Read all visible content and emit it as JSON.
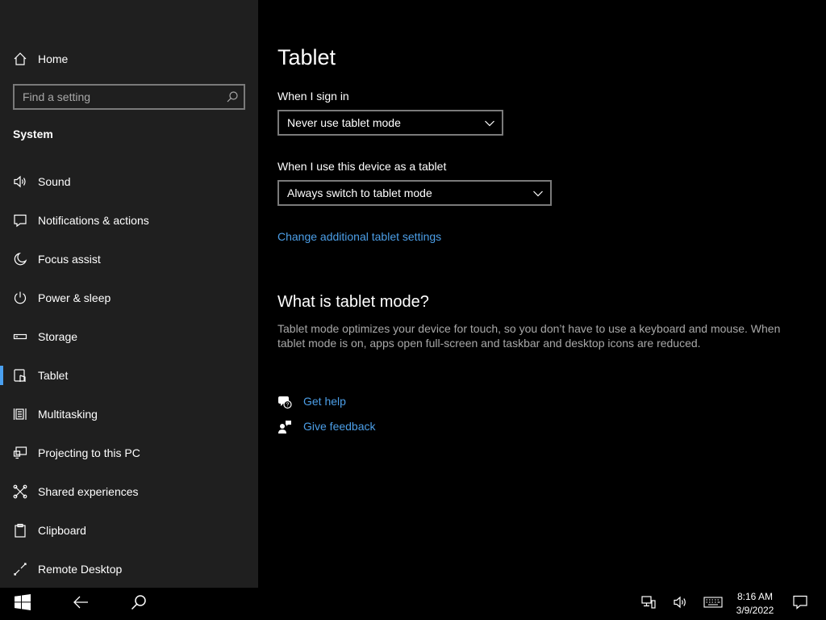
{
  "sidebar": {
    "home_label": "Home",
    "search_placeholder": "Find a setting",
    "section_title": "System",
    "items": [
      {
        "label": "Sound",
        "icon": "speaker-icon"
      },
      {
        "label": "Notifications & actions",
        "icon": "notification-icon"
      },
      {
        "label": "Focus assist",
        "icon": "moon-icon"
      },
      {
        "label": "Power & sleep",
        "icon": "power-icon"
      },
      {
        "label": "Storage",
        "icon": "storage-icon"
      },
      {
        "label": "Tablet",
        "icon": "tablet-icon",
        "active": true
      },
      {
        "label": "Multitasking",
        "icon": "multitasking-icon"
      },
      {
        "label": "Projecting to this PC",
        "icon": "projecting-icon"
      },
      {
        "label": "Shared experiences",
        "icon": "shared-icon"
      },
      {
        "label": "Clipboard",
        "icon": "clipboard-icon"
      },
      {
        "label": "Remote Desktop",
        "icon": "remote-desktop-icon"
      }
    ]
  },
  "main": {
    "title": "Tablet",
    "sign_in_label": "When I sign in",
    "sign_in_value": "Never use tablet mode",
    "device_label": "When I use this device as a tablet",
    "device_value": "Always switch to tablet mode",
    "additional_link": "Change additional tablet settings",
    "what_heading": "What is tablet mode?",
    "what_desc": "Tablet mode optimizes your device for touch, so you don’t have to use a keyboard and mouse. When tablet mode is on, apps open full-screen and taskbar and desktop icons are reduced.",
    "get_help": "Get help",
    "give_feedback": "Give feedback"
  },
  "taskbar": {
    "time": "8:16 AM",
    "date": "3/9/2022"
  },
  "colors": {
    "accent": "#4aa0f0",
    "link": "#4c9fe8",
    "sidebar_bg": "#1f1f1f",
    "main_bg": "#000000"
  }
}
